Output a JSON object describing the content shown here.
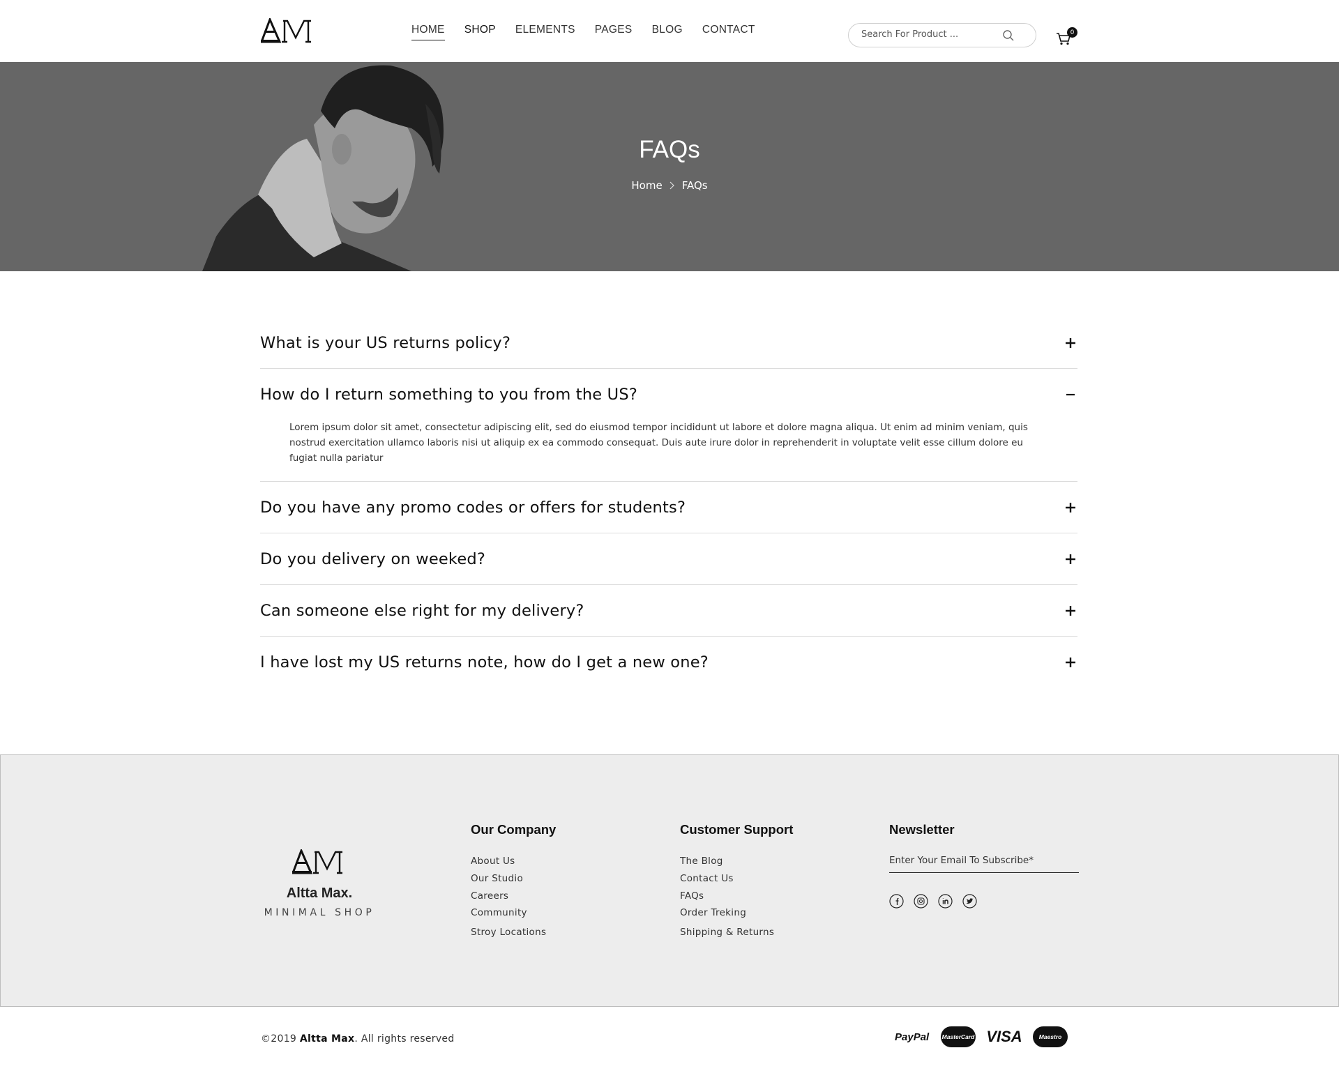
{
  "header": {
    "logo_text": "AM",
    "nav": [
      {
        "label": "HOME",
        "active": true
      },
      {
        "label": "SHOP",
        "active": false
      },
      {
        "label": "ELEMENTS",
        "active": false
      },
      {
        "label": "PAGES",
        "active": false
      },
      {
        "label": "BLOG",
        "active": false
      },
      {
        "label": "CONTACT",
        "active": false
      }
    ],
    "search_placeholder": "Search For Product ...",
    "cart_count": "0"
  },
  "hero": {
    "title": "FAQs",
    "breadcrumb": [
      "Home",
      "FAQs"
    ]
  },
  "faq": {
    "items": [
      {
        "question": "What is your US returns policy?",
        "expanded": false,
        "answer": ""
      },
      {
        "question": "How do I return something to you from the US?",
        "expanded": true,
        "answer": "Lorem ipsum dolor sit amet, consectetur adipiscing elit, sed do eiusmod tempor incididunt ut labore et dolore magna aliqua. Ut enim ad minim veniam, quis nostrud exercitation ullamco laboris nisi ut aliquip ex ea commodo consequat. Duis aute irure dolor in reprehenderit in voluptate velit esse cillum dolore eu fugiat nulla pariatur"
      },
      {
        "question": "Do you have any promo codes or offers for students?",
        "expanded": false,
        "answer": ""
      },
      {
        "question": "Do you delivery on weeked?",
        "expanded": false,
        "answer": ""
      },
      {
        "question": "Can someone else right for my delivery?",
        "expanded": false,
        "answer": ""
      },
      {
        "question": "I have lost my US returns note, how do I get a new one?",
        "expanded": false,
        "answer": ""
      }
    ]
  },
  "footer": {
    "brand": "Altta Max.",
    "tagline": "MINIMAL SHOP",
    "company": {
      "title": "Our Company",
      "links": [
        "About Us",
        "Our Studio",
        "Careers",
        "Community",
        "Stroy Locations"
      ]
    },
    "support": {
      "title": "Customer Support",
      "links": [
        "The Blog",
        "Contact Us",
        "FAQs",
        "Order Treking",
        "Shipping & Returns"
      ]
    },
    "newsletter": {
      "title": "Newsletter",
      "placeholder": "Enter Your Email To Subscribe*"
    },
    "socials": [
      "facebook-icon",
      "instagram-icon",
      "linkedin-icon",
      "twitter-icon"
    ]
  },
  "bottom": {
    "copyright_prefix": "©2019",
    "copyright_brand": "Altta Max",
    "copyright_suffix": ". All rights reserved",
    "payments": [
      "PayPal",
      "MasterCard",
      "VISA",
      "Maestro"
    ]
  },
  "colors": {
    "hero_bg": "#666666",
    "footer_bg": "#ededed",
    "text": "#111111"
  }
}
